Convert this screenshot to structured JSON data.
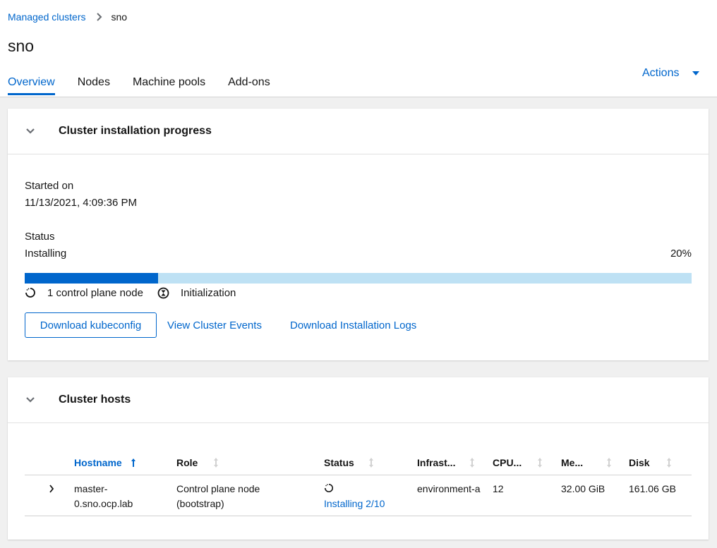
{
  "breadcrumb": {
    "parent": "Managed clusters",
    "current": "sno"
  },
  "page": {
    "title": "sno"
  },
  "tabs": [
    {
      "label": "Overview",
      "active": true
    },
    {
      "label": "Nodes",
      "active": false
    },
    {
      "label": "Machine pools",
      "active": false
    },
    {
      "label": "Add-ons",
      "active": false
    }
  ],
  "actions": {
    "label": "Actions"
  },
  "install": {
    "title": "Cluster installation progress",
    "started_label": "Started on",
    "started_value": "11/13/2021, 4:09:36 PM",
    "status_label": "Status",
    "status_value": "Installing",
    "percent_text": "20%",
    "percent": 20,
    "step1": "1 control plane node",
    "step2": "Initialization",
    "download_kubeconfig": "Download kubeconfig",
    "view_events": "View Cluster Events",
    "download_logs": "Download Installation Logs"
  },
  "hosts": {
    "title": "Cluster hosts",
    "columns": [
      "Hostname",
      "Role",
      "Status",
      "Infrast...",
      "CPU...",
      "Me...",
      "Disk"
    ],
    "rows": [
      {
        "hostname_1": "master-",
        "hostname_2": "0.sno.ocp.lab",
        "role_1": "Control plane node",
        "role_2": "(bootstrap)",
        "status": "Installing 2/10",
        "infra": "environment-a",
        "cpu": "12",
        "memory": "32.00 GiB",
        "disk": "161.06 GB"
      }
    ]
  },
  "colors": {
    "accent": "#0066cc",
    "progress_track": "#bee1f4"
  }
}
